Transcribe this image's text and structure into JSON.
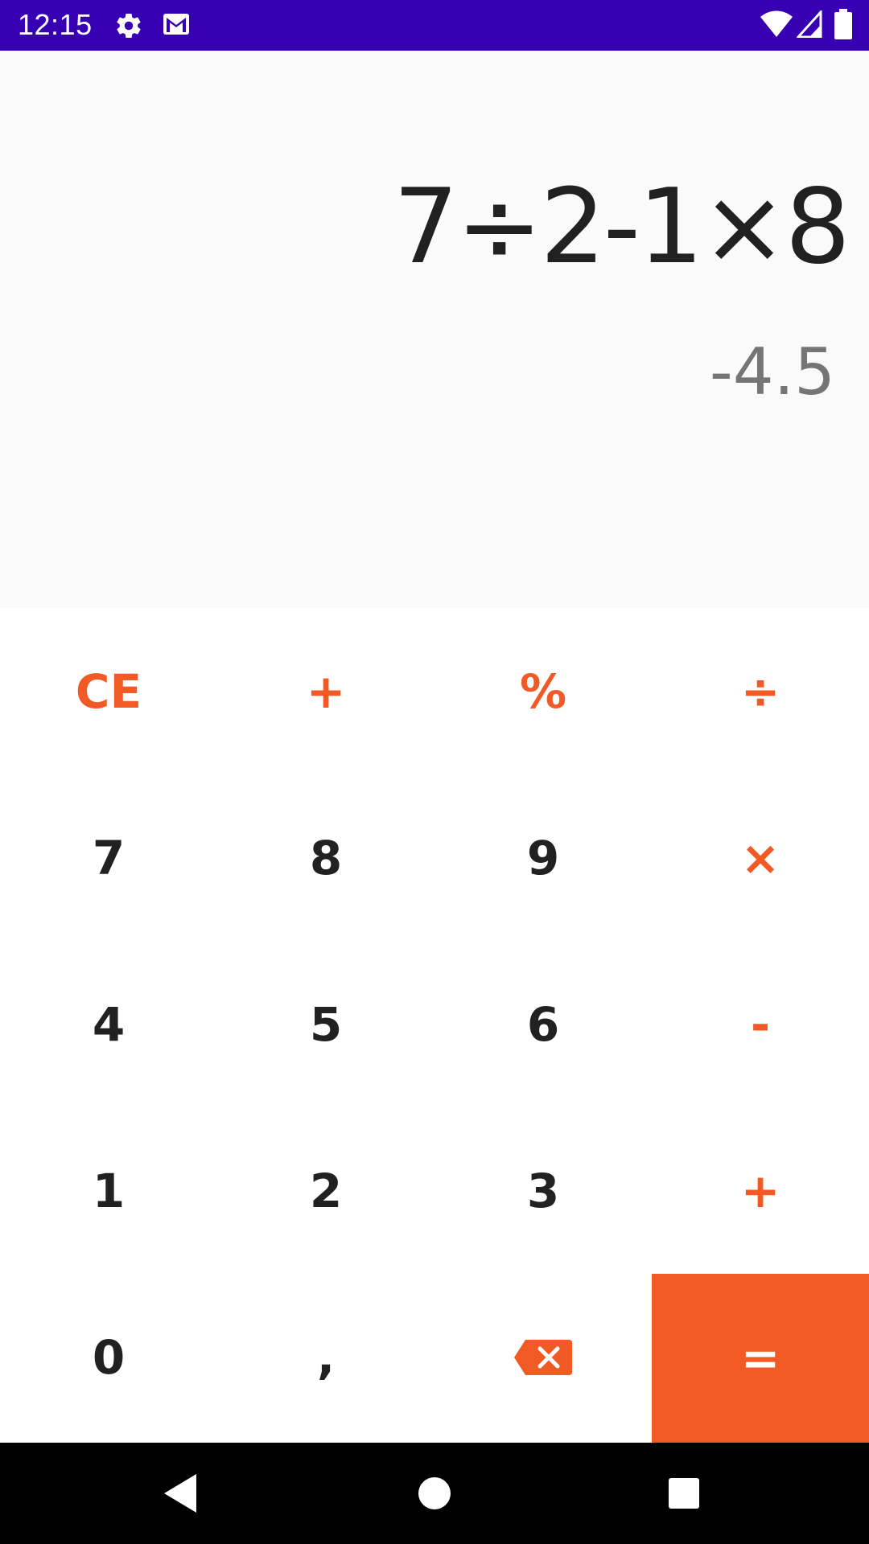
{
  "status_bar": {
    "time": "12:15",
    "icons_left": [
      "gear-icon",
      "gmail-icon"
    ],
    "icons_right": [
      "wifi-icon",
      "signal-icon",
      "battery-icon"
    ],
    "color": "#3700b3"
  },
  "display": {
    "expression": "7÷2-1×8",
    "result": "-4.5"
  },
  "keypad": {
    "accent_color": "#f15a24",
    "rows": [
      [
        "CE",
        "+",
        "%",
        "÷"
      ],
      [
        "7",
        "8",
        "9",
        "×"
      ],
      [
        "4",
        "5",
        "6",
        "-"
      ],
      [
        "1",
        "2",
        "3",
        "+"
      ],
      [
        "0",
        ",",
        "backspace-icon",
        "="
      ]
    ]
  },
  "navigation": {
    "buttons": [
      "back-icon",
      "home-icon",
      "recents-icon"
    ]
  }
}
